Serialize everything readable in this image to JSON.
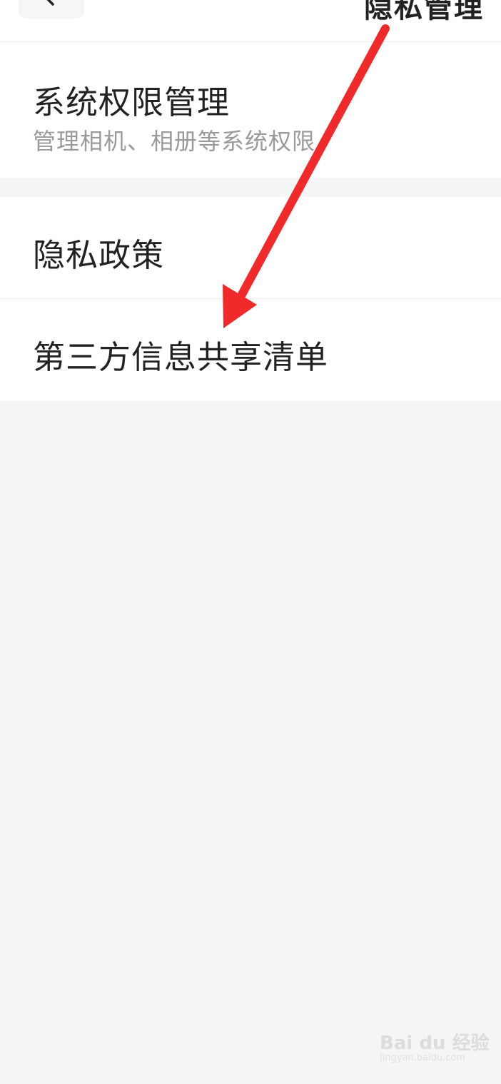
{
  "header": {
    "title": "隐私管理",
    "back_icon": "chevron-left-icon"
  },
  "sections": [
    {
      "items": [
        {
          "title": "系统权限管理",
          "subtitle": "管理相机、相册等系统权限"
        }
      ]
    },
    {
      "items": [
        {
          "title": "隐私政策"
        },
        {
          "title": "第三方信息共享清单"
        }
      ]
    }
  ],
  "annotation": {
    "type": "arrow",
    "color": "#f02a2a",
    "target": "第三方信息共享清单"
  },
  "watermark": {
    "logo": "Bai du 经验",
    "url": "jingyan.baidu.com"
  },
  "colors": {
    "background": "#f4f5f7",
    "card": "#ffffff",
    "title_text": "#222222",
    "subtitle_text": "#9a9a9a"
  }
}
